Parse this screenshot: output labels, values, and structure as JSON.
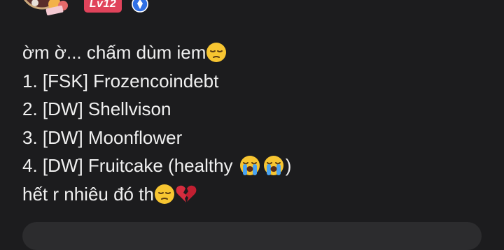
{
  "header": {
    "level_badge": "Lv12",
    "icons": [
      "avatar-image",
      "verified-badge-icon"
    ]
  },
  "post": {
    "lines": [
      "ờm ờ... chấm dùm iem",
      "1. [FSK] Frozencoindebt",
      "2. [DW] Shellvison",
      "3. [DW] Moonflower",
      "4. [DW] Fruitcake (healthy ",
      ")",
      "hết r nhiêu đó th"
    ],
    "emojis": [
      "pensive-face",
      "loudly-crying-face",
      "loudly-crying-face",
      "pensive-face",
      "broken-heart"
    ]
  },
  "colors": {
    "background": "#1c1c1e",
    "text": "#f0f0f0",
    "level_badge": "#e0435b",
    "verified": "#2f6fe4",
    "comment_box": "#2c2c2e"
  }
}
